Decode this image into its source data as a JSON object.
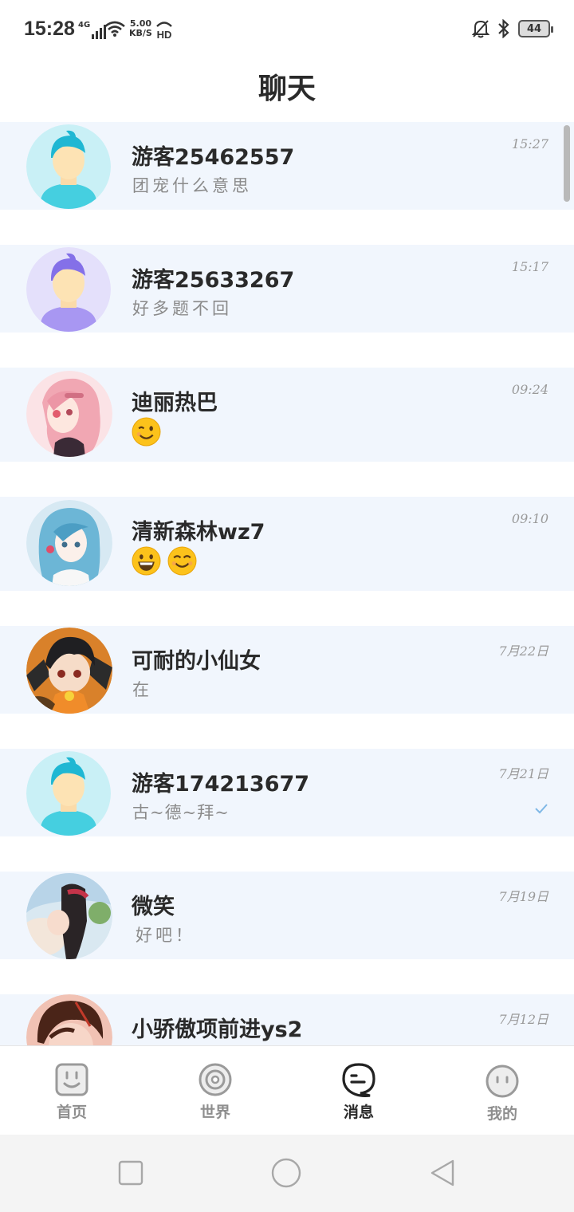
{
  "status_bar": {
    "time": "15:28",
    "network": "4G",
    "speed_value": "5.00",
    "speed_unit": "KB/S",
    "hd": "HD",
    "battery": "44"
  },
  "header": {
    "title": "聊天"
  },
  "chats": [
    {
      "name": "游客25462557",
      "preview": "团宠什么意思",
      "time": "15:27",
      "avatar": "default-boy-teal-avatar"
    },
    {
      "name": "游客25633267",
      "preview": "好多题不回",
      "time": "15:17",
      "avatar": "default-boy-purple-avatar"
    },
    {
      "name": "迪丽热巴",
      "preview_emojis": [
        "wink-emoji"
      ],
      "time": "09:24",
      "avatar": "pink-hair-girl-avatar"
    },
    {
      "name": "清新森林wz7",
      "preview_emojis": [
        "grin-emoji",
        "smile-emoji"
      ],
      "time": "09:10",
      "avatar": "blue-hair-girl-avatar"
    },
    {
      "name": "可耐的小仙女",
      "preview": "在",
      "time": "7月22日",
      "avatar": "anime-boy-orange-avatar"
    },
    {
      "name": "游客174213677",
      "preview": "古~德~拜~",
      "time": "7月21日",
      "avatar": "default-boy-teal-avatar",
      "read_check": "check-icon"
    },
    {
      "name": "微笑",
      "preview": "好吧！",
      "time": "7月19日",
      "avatar": "girl-photo-avatar"
    },
    {
      "name": "小骄傲项前进ys2",
      "time": "7月12日",
      "avatar": "anime-man-avatar"
    }
  ],
  "bottom_nav": [
    {
      "label": "首页",
      "icon": "home-face-icon",
      "active": false
    },
    {
      "label": "世界",
      "icon": "world-ring-icon",
      "active": false
    },
    {
      "label": "消息",
      "icon": "message-bubble-icon",
      "active": true
    },
    {
      "label": "我的",
      "icon": "profile-face-icon",
      "active": false
    }
  ],
  "system_nav": {
    "icons": [
      "recent-apps-icon",
      "home-circle-icon",
      "back-triangle-icon"
    ]
  },
  "colors": {
    "row_bg": "#f1f6fd",
    "text_dark": "#2a2a2a",
    "text_gray": "#8a8a8a",
    "check": "#7fb8e6"
  }
}
